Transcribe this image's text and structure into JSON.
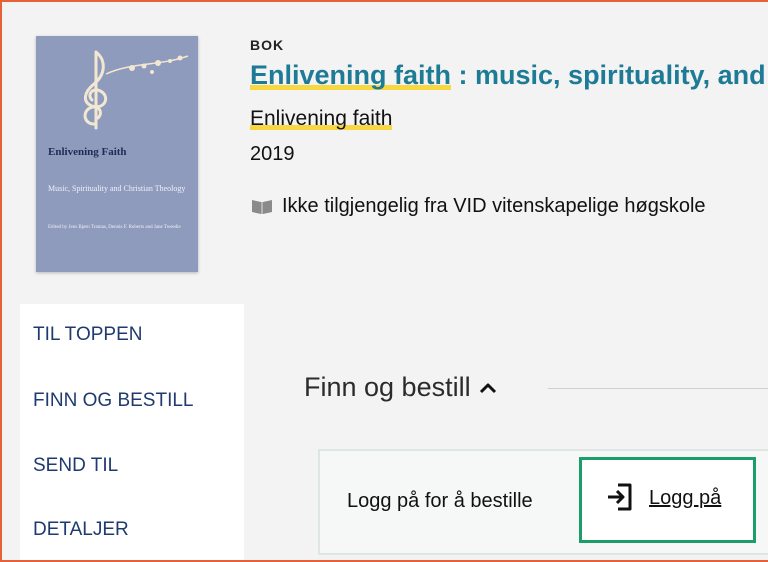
{
  "record": {
    "type": "BOK",
    "title_highlight": "Enlivening faith",
    "title_rest": " : music, spirituality, and Christian theology",
    "alt_title": "Enlivening faith",
    "year": "2019",
    "availability": "Ikke tilgjengelig fra VID vitenskapelige høgskole"
  },
  "cover": {
    "title": "Enlivening Faith",
    "subtitle": "Music, Spirituality and Christian Theology",
    "editors": "Edited by Jens Bjørn Tramas, Dennis F. Roberts and Jane Tweedie"
  },
  "sidenav": {
    "items": [
      "TIL TOPPEN",
      "FINN OG BESTILL",
      "SEND TIL",
      "DETALJER"
    ]
  },
  "section": {
    "title": "Finn og bestill"
  },
  "login": {
    "prompt": "Logg på for å bestille",
    "button_label": "Logg på"
  },
  "colors": {
    "title": "#1e7b96",
    "highlight": "#f7d742",
    "login_border": "#1b9e6a",
    "frame_border": "#e6603a",
    "nav_text": "#1f3a6e"
  }
}
